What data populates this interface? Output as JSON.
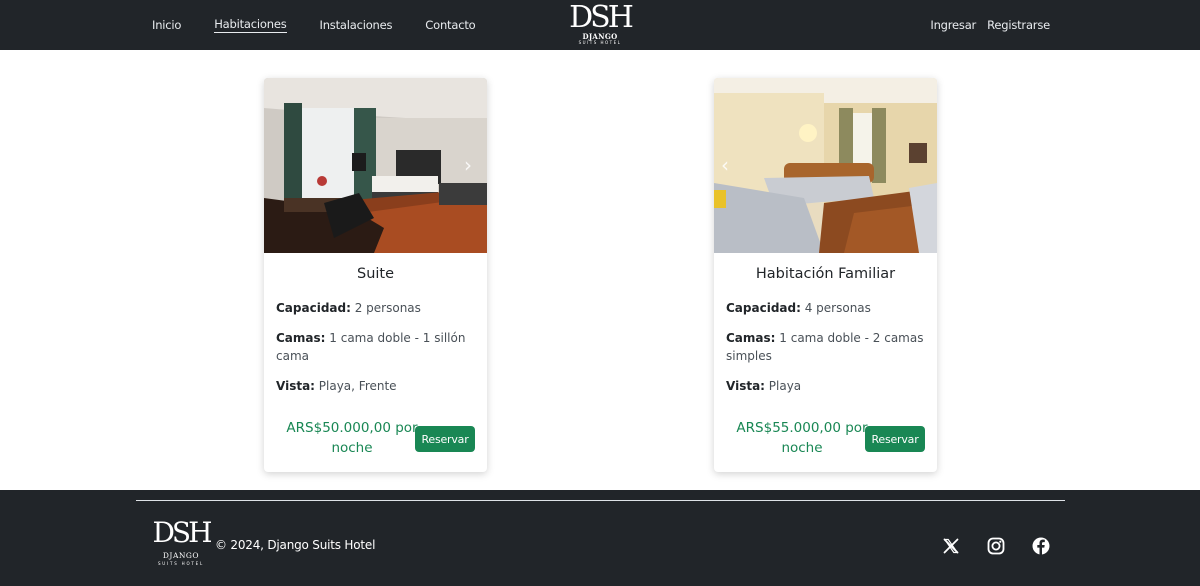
{
  "nav": {
    "links": [
      {
        "label": "Inicio"
      },
      {
        "label": "Habitaciones"
      },
      {
        "label": "Instalaciones"
      },
      {
        "label": "Contacto"
      }
    ],
    "login": "Ingresar",
    "register": "Registrarse"
  },
  "logo": {
    "mark": "DSH",
    "name": "DJANGO",
    "tagline": "SUITS HOTEL"
  },
  "rooms": [
    {
      "title": "Suite",
      "capacity_label": "Capacidad:",
      "capacity": " 2 personas",
      "beds_label": "Camas:",
      "beds": " 1 cama doble - 1 sillón cama",
      "view_label": "Vista:",
      "view": " Playa, Frente",
      "price": "ARS$50.000,00 por noche",
      "button": "Reservar"
    },
    {
      "title": "Habitación Familiar",
      "capacity_label": "Capacidad:",
      "capacity": " 4 personas",
      "beds_label": "Camas:",
      "beds": " 1 cama doble - 2 camas simples",
      "view_label": "Vista:",
      "view": " Playa",
      "price": "ARS$55.000,00 por noche",
      "button": "Reservar"
    }
  ],
  "footer": {
    "copyright": "© 2024, Django Suits Hotel",
    "logo_mark": "DSH",
    "logo_name": "DJANGO",
    "logo_tagline": "SUITS HOTEL",
    "socials": [
      "x-icon",
      "instagram-icon",
      "facebook-icon"
    ]
  },
  "colors": {
    "navbar_bg": "#212529",
    "accent_green": "#198754"
  }
}
